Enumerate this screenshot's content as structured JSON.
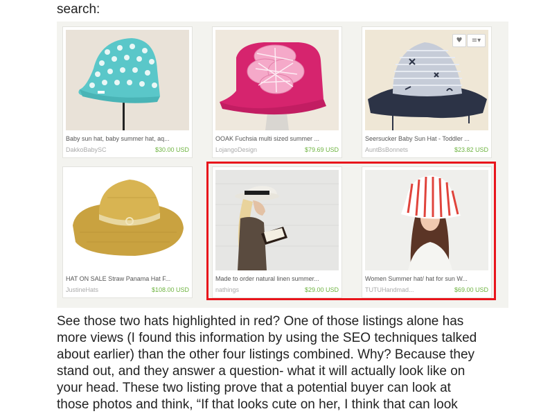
{
  "intro_text": "search:",
  "listings": [
    {
      "title": "Baby sun hat, baby summer hat, aq...",
      "shop": "DakkoBabySC",
      "price": "$30.00 USD"
    },
    {
      "title": "OOAK Fuchsia multi sized summer ...",
      "shop": "LojangoDesign",
      "price": "$79.69 USD"
    },
    {
      "title": "Seersucker Baby Sun Hat - Toddler ...",
      "shop": "AuntBsBonnets",
      "price": "$23.82 USD"
    },
    {
      "title": "HAT ON SALE Straw Panama Hat F...",
      "shop": "JustineHats",
      "price": "$108.00 USD"
    },
    {
      "title": "Made to order natural linen summer...",
      "shop": "nathings",
      "price": "$29.00 USD"
    },
    {
      "title": "Women Summer hat/ hat for sun W...",
      "shop": "TUTUHandmad...",
      "price": "$69.00 USD"
    }
  ],
  "card_icons": {
    "favorite": "heart-icon",
    "list": "list-icon"
  },
  "highlight_color": "#e8141b",
  "price_color": "#6db33f",
  "article_lines": [
    "See those two hats highlighted in red? One of those listings alone has",
    "more views (I found this information by using the SEO techniques talked",
    "about earlier) than the other four listings combined. Why? Because they",
    "stand out, and they answer a question- what it will actually look like on",
    "your head. These two listing prove that a potential buyer can look at",
    "those photos and think, “If that looks cute on her, I think that can look"
  ]
}
